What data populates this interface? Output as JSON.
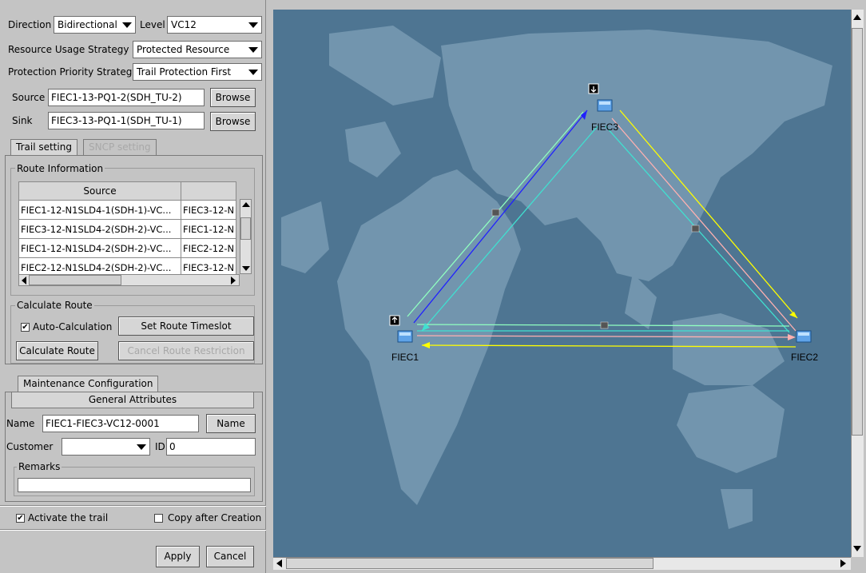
{
  "form": {
    "direction": {
      "label": "Direction",
      "value": "Bidirectional"
    },
    "level": {
      "label": "Level",
      "value": "VC12"
    },
    "resource_usage": {
      "label": "Resource Usage Strategy",
      "value": "Protected Resource"
    },
    "protection_priority": {
      "label": "Protection Priority Strategy",
      "value": "Trail Protection First"
    },
    "source": {
      "label": "Source",
      "value": "FIEC1-13-PQ1-2(SDH_TU-2)",
      "button": "Browse"
    },
    "sink": {
      "label": "Sink",
      "value": "FIEC3-13-PQ1-1(SDH_TU-1)",
      "button": "Browse"
    }
  },
  "tabs": [
    "Trail setting",
    "SNCP setting"
  ],
  "route_info": {
    "title": "Route Information",
    "columns": [
      "Source",
      ""
    ],
    "rows": [
      [
        "FIEC1-12-N1SLD4-1(SDH-1)-VC...",
        "FIEC3-12-N"
      ],
      [
        "FIEC3-12-N1SLD4-2(SDH-2)-VC...",
        "FIEC1-12-N"
      ],
      [
        "FIEC1-12-N1SLD4-2(SDH-2)-VC...",
        "FIEC2-12-N"
      ],
      [
        "FIEC2-12-N1SLD4-2(SDH-2)-VC...",
        "FIEC3-12-N"
      ]
    ]
  },
  "calculate": {
    "title": "Calculate Route",
    "auto_label": "Auto-Calculation",
    "auto_checked": true,
    "set_timeslot": "Set Route Timeslot",
    "calc_button": "Calculate Route",
    "cancel_restriction": "Cancel Route Restriction"
  },
  "maintenance": {
    "tab": "Maintenance Configuration",
    "subtab": "General Attributes",
    "name_label": "Name",
    "name_value": "FIEC1-FIEC3-VC12-0001",
    "name_button": "Name",
    "customer_label": "Customer",
    "customer_value": "",
    "id_label": "ID",
    "id_value": "0",
    "remarks_label": "Remarks",
    "remarks_value": ""
  },
  "bottom": {
    "activate_label": "Activate the trail",
    "activate_checked": true,
    "copy_label": "Copy after Creation",
    "copy_checked": false,
    "apply": "Apply",
    "cancel": "Cancel"
  },
  "map": {
    "nodes": {
      "fiec1": "FIEC1",
      "fiec2": "FIEC2",
      "fiec3": "FIEC3"
    },
    "colors": {
      "ocean": "#4e7592",
      "land": "#7295ae",
      "cyan": "#40e0d0",
      "blue": "#2020ff",
      "yellow": "#ffff00",
      "pink": "#ffb0b0",
      "lightgreen": "#90ffc0"
    }
  }
}
